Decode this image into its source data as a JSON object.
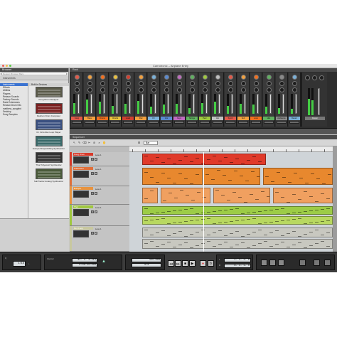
{
  "window": {
    "title": "Carnotronic – Airplane Entry"
  },
  "browser": {
    "header": "Browser",
    "search_placeholder": "Reason Browser Bars",
    "filter": "Instruments",
    "locations": [
      "Instruments",
      "Effects",
      "Utilities",
      "Players",
      "Reason Sounds",
      "Factory Sounds",
      "Rack Extensions",
      "Reason Drum Kits",
      "matthew_songbird",
      "Desktop",
      "Song Samples"
    ],
    "selected_location": 0,
    "devices_header": "Built-in Devices",
    "devices": [
      "Kong Drum Designer",
      "Redrum Drum Computer",
      "Dr. Octo Rex Loop Player",
      "Europa Shapeshifting Synthesizer",
      "Thor Polysonic Synthesizer",
      "SubTractor Analog Synthesizer"
    ],
    "device_colors": [
      "#5a5a4a",
      "#7a2020",
      "#3a5080",
      "#3a6a6a",
      "#333333",
      "#4a5a3a"
    ]
  },
  "rack": {
    "header": "Rack",
    "channels": [
      {
        "name": "Kong",
        "color": "#e05a4a",
        "level": 0.55
      },
      {
        "name": "Bass",
        "color": "#f0a040",
        "level": 0.7
      },
      {
        "name": "Drums",
        "color": "#f07020",
        "level": 0.6
      },
      {
        "name": "Chords",
        "color": "#e8c040",
        "level": 0.4
      },
      {
        "name": "Lead",
        "color": "#d04030",
        "level": 0.5
      },
      {
        "name": "Pad",
        "color": "#f0a040",
        "level": 0.65
      },
      {
        "name": "FX",
        "color": "#7ab0d8",
        "level": 0.35
      },
      {
        "name": "Vox",
        "color": "#5a8ad0",
        "level": 0.45
      },
      {
        "name": "Keys",
        "color": "#c06ac0",
        "level": 0.5
      },
      {
        "name": "Strings",
        "color": "#60b060",
        "level": 0.3
      },
      {
        "name": "Perc",
        "color": "#a0c840",
        "level": 0.55
      },
      {
        "name": "Arp",
        "color": "#c0c0c0",
        "level": 0.6
      },
      {
        "name": "Synth",
        "color": "#e05a4a",
        "level": 0.4
      },
      {
        "name": "Sub",
        "color": "#f0a040",
        "level": 0.5
      },
      {
        "name": "Loop",
        "color": "#f07020",
        "level": 0.45
      },
      {
        "name": "Hits",
        "color": "#60b060",
        "level": 0.35
      },
      {
        "name": "Ambience",
        "color": "#8a8a8a",
        "level": 0.3
      },
      {
        "name": "Return",
        "color": "#7ab0d8",
        "level": 0.25
      }
    ],
    "master_label": "Master"
  },
  "sequencer": {
    "header": "Sequencer",
    "snap": "Bar",
    "tracks": [
      {
        "name": "Kong Drum",
        "color": "#d83a2a",
        "lane": "Lane 1"
      },
      {
        "name": "Subtractor",
        "color": "#e0703a",
        "lane": "Lane 1"
      },
      {
        "name": "Europa",
        "color": "#e89440",
        "lane": "Lane 1"
      },
      {
        "name": "Thor",
        "color": "#a0c840",
        "lane": "Lane 1"
      },
      {
        "name": "Rex Loop",
        "color": "#c8c8a0",
        "lane": "Lane 1"
      }
    ],
    "clip_colors": {
      "red": "#e03a2a",
      "orange": "#e8882e",
      "orangeLight": "#f0a060",
      "green": "#9ccc46",
      "lime": "#b8d860",
      "gray": "#c8c8c0"
    }
  },
  "transport": {
    "pos_bars": "31. 1. 4.211",
    "pos_time": "0:00:56:000",
    "tempo": "125.000",
    "signature": "4/4",
    "left_loc": "1. 1. 1. 0",
    "right_loc": "9. 1. 1. 0",
    "quantize": "1/16",
    "keys_label": "Q",
    "internal_label": "Internal",
    "btn_stop": "■",
    "btn_play": "▶",
    "btn_rec": "●",
    "btn_rew": "◀◀",
    "btn_ff": "▶▶",
    "btn_loop": "↻"
  }
}
